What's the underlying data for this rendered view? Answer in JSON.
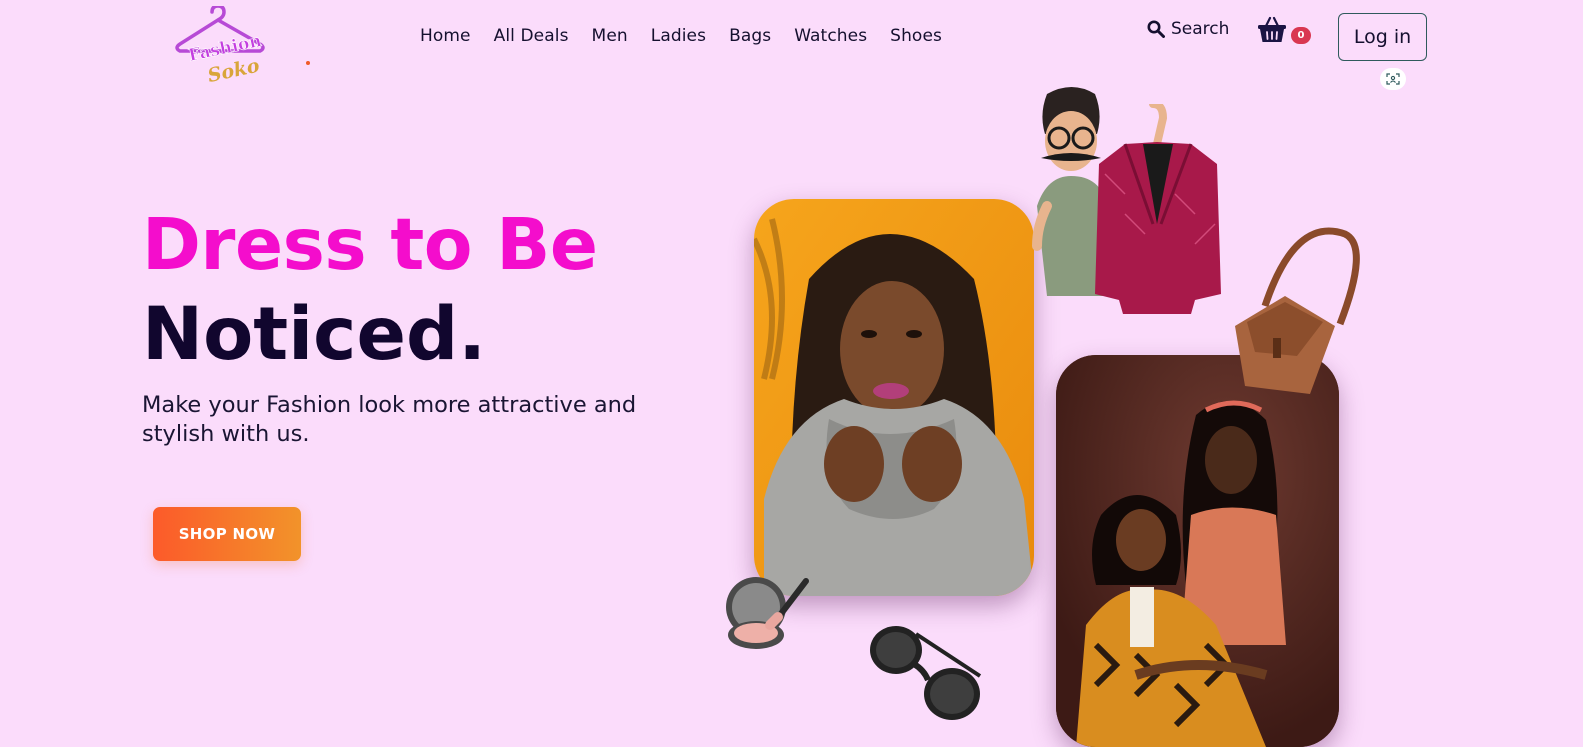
{
  "brand": {
    "line1": "Fashion",
    "line2": "Soko"
  },
  "nav": {
    "items": [
      {
        "label": "Home"
      },
      {
        "label": "All Deals"
      },
      {
        "label": "Men"
      },
      {
        "label": "Ladies"
      },
      {
        "label": "Bags"
      },
      {
        "label": "Watches"
      },
      {
        "label": "Shoes"
      }
    ]
  },
  "header": {
    "search_label": "Search",
    "cart_count": "0",
    "login_label": "Log in"
  },
  "hero": {
    "headline_1": "Dress to Be",
    "headline_2": "Noticed.",
    "subtext": "Make your Fashion look more attractive and stylish with us.",
    "cta_label": "SHOP NOW"
  },
  "colors": {
    "background": "#fbdcfb",
    "accent_pink": "#f40dcc",
    "dark_navy": "#11062e",
    "cta_start": "#fc5a2a",
    "cta_end": "#f2932a",
    "badge": "#d93751"
  },
  "icons": [
    "hanger-logo-icon",
    "search-icon",
    "basket-icon",
    "user-scan-icon",
    "cartoon-man-icon",
    "blazer-icon",
    "handbag-icon",
    "compact-mirror-icon",
    "sunglasses-icon"
  ]
}
